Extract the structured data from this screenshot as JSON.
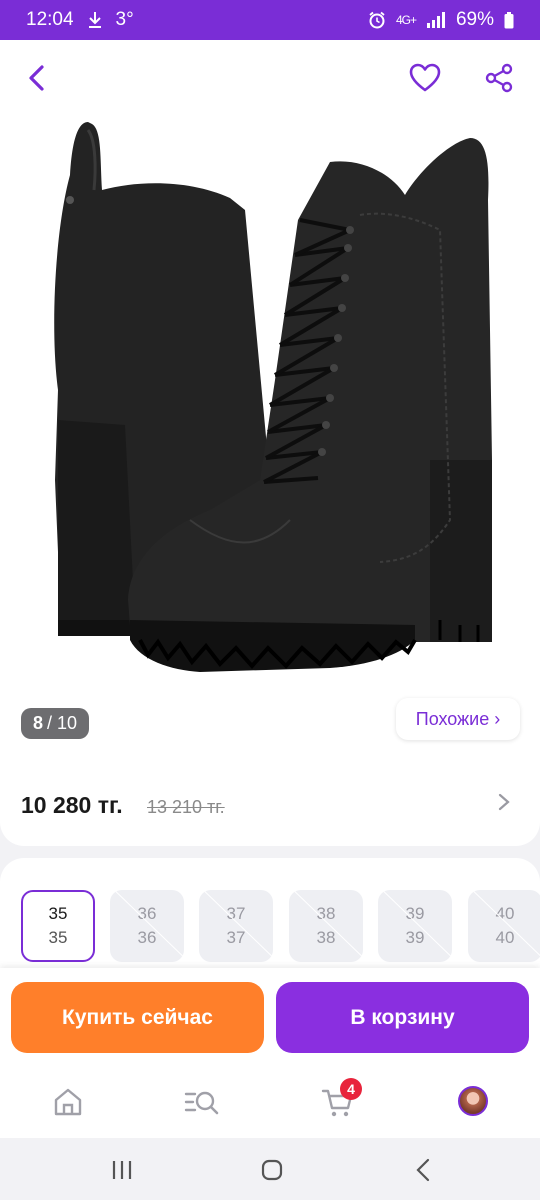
{
  "status_bar": {
    "time": "12:04",
    "download_icon": "download-arrow-icon",
    "temperature": "3°",
    "alarm_icon": "alarm-icon",
    "network_label": "4G+",
    "battery_text": "69%"
  },
  "gallery": {
    "image_current": "8",
    "image_total": "/ 10",
    "similar_label": "Похожие ›"
  },
  "price": {
    "current": "10 280 тг.",
    "old": "13 210 тг."
  },
  "sizes": [
    {
      "label": "35",
      "alt": "35",
      "available": true,
      "selected": true
    },
    {
      "label": "36",
      "alt": "36",
      "available": false,
      "selected": false
    },
    {
      "label": "37",
      "alt": "37",
      "available": false,
      "selected": false
    },
    {
      "label": "38",
      "alt": "38",
      "available": false,
      "selected": false
    },
    {
      "label": "39",
      "alt": "39",
      "available": false,
      "selected": false
    },
    {
      "label": "40",
      "alt": "40",
      "available": false,
      "selected": false
    }
  ],
  "actions": {
    "buy_now": "Купить сейчас",
    "add_to_cart": "В корзину"
  },
  "tab_bar": {
    "cart_count": "4",
    "icons": [
      "home-icon",
      "catalog-search-icon",
      "cart-icon",
      "profile-avatar"
    ]
  },
  "colors": {
    "brand": "#7a2dd6",
    "buy_button": "#ff7f2a",
    "cart_button": "#8a2fe0",
    "badge": "#e8243c"
  }
}
